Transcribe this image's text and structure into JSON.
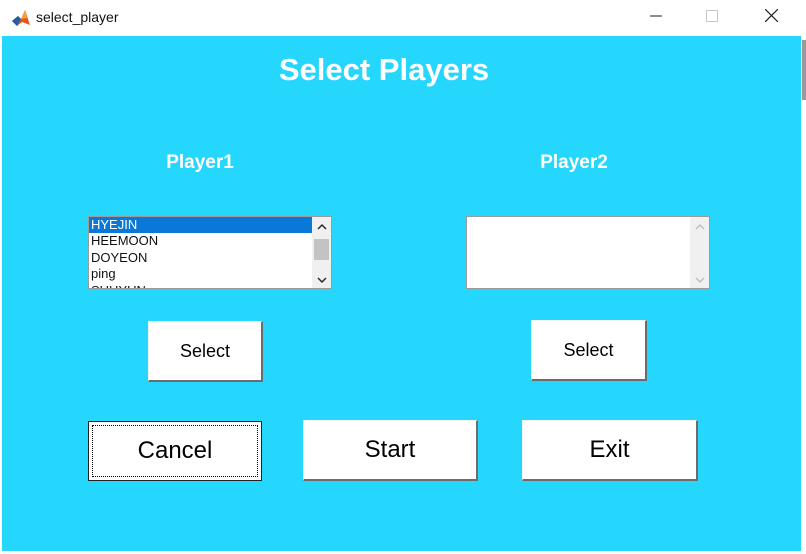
{
  "window": {
    "title": "select_player",
    "icon": "matlab-logo-icon"
  },
  "colors": {
    "background": "#25d6fd",
    "heading_text": "#ffffff",
    "selection": "#0a78d7"
  },
  "heading": "Select Players",
  "player1": {
    "label": "Player1",
    "items": [
      "HYEJIN",
      "HEEMOON",
      "DOYEON",
      "ping",
      "SUHYUN"
    ],
    "selected_index": 0,
    "select_button": "Select"
  },
  "player2": {
    "label": "Player2",
    "items": [],
    "select_button": "Select"
  },
  "actions": {
    "cancel": "Cancel",
    "start": "Start",
    "exit": "Exit"
  }
}
